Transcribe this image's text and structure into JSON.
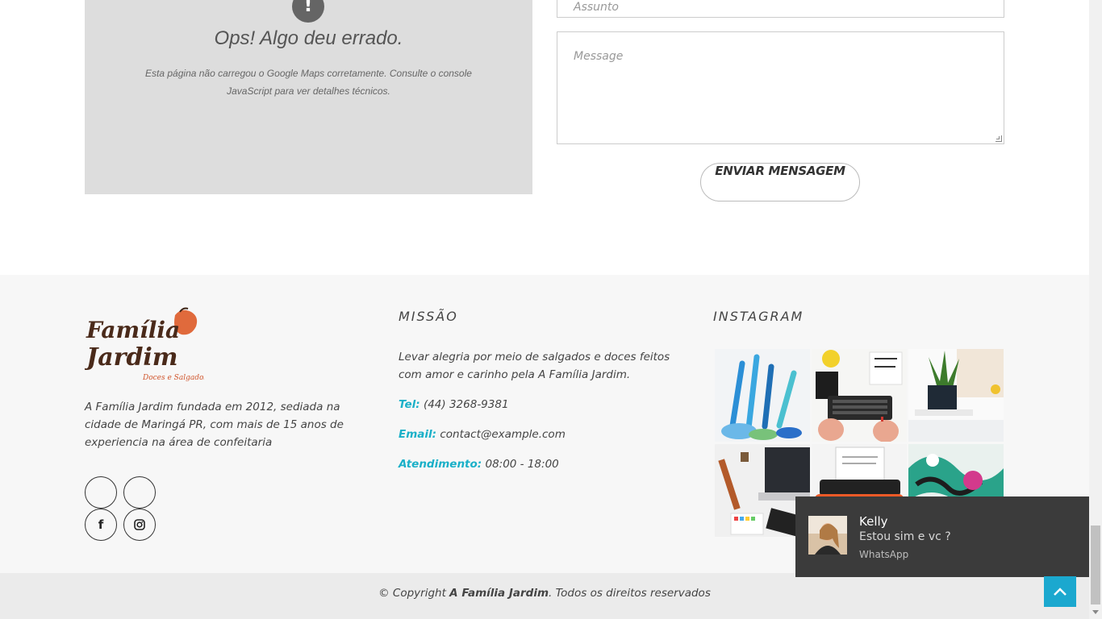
{
  "map": {
    "icon": "exclamation-icon",
    "icon_glyph": "!",
    "title": "Ops! Algo deu errado.",
    "message": "Esta página não carregou o Google Maps corretamente. Consulte o console JavaScript para ver detalhes técnicos."
  },
  "contact_form": {
    "subject_placeholder": "Assunto",
    "message_placeholder": "Message",
    "send_label": "ENVIAR MENSAGEM"
  },
  "footer": {
    "logo_alt": "Família Jardim Doces e Salgados",
    "about": "A Família Jardim fundada em 2012, sediada na cidade de Maringá PR, com mais de 15 anos de experiencia na área de confeitaria",
    "social": [
      {
        "icon": "empty-social-icon",
        "glyph": ""
      },
      {
        "icon": "empty-social-icon",
        "glyph": ""
      },
      {
        "icon": "facebook-icon",
        "glyph": "f"
      },
      {
        "icon": "instagram-icon",
        "glyph": ""
      }
    ],
    "mission": {
      "title": "MISSÃO",
      "text": "Levar alegria por meio de salgados e doces feitos com amor e carinho pela A Família Jardim.",
      "tel_label": "Tel:",
      "tel_value": "(44) 3268-9381",
      "email_label": "Email:",
      "email_value": "contact@example.com",
      "hours_label": "Atendimento:",
      "hours_value": "08:00 - 18:00"
    },
    "instagram": {
      "title": "INSTAGRAM",
      "images": [
        "colored-pencils-photo",
        "keyboard-desk-photo",
        "plant-desk-photo",
        "laptop-desk-photo",
        "typewriter-photo",
        "fluid-art-photo"
      ]
    }
  },
  "copyright": {
    "prefix": "© Copyright ",
    "brand": "A Família Jardim",
    "suffix": ". Todos os direitos reservados"
  },
  "notification": {
    "name": "Kelly",
    "message": "Estou sim e vc ?",
    "app": "WhatsApp"
  },
  "colors": {
    "accent": "#1ab0c8",
    "to_top": "#1ba8cf",
    "footer_bg": "#f7f7f7",
    "notification_bg": "#3b3b3b"
  }
}
